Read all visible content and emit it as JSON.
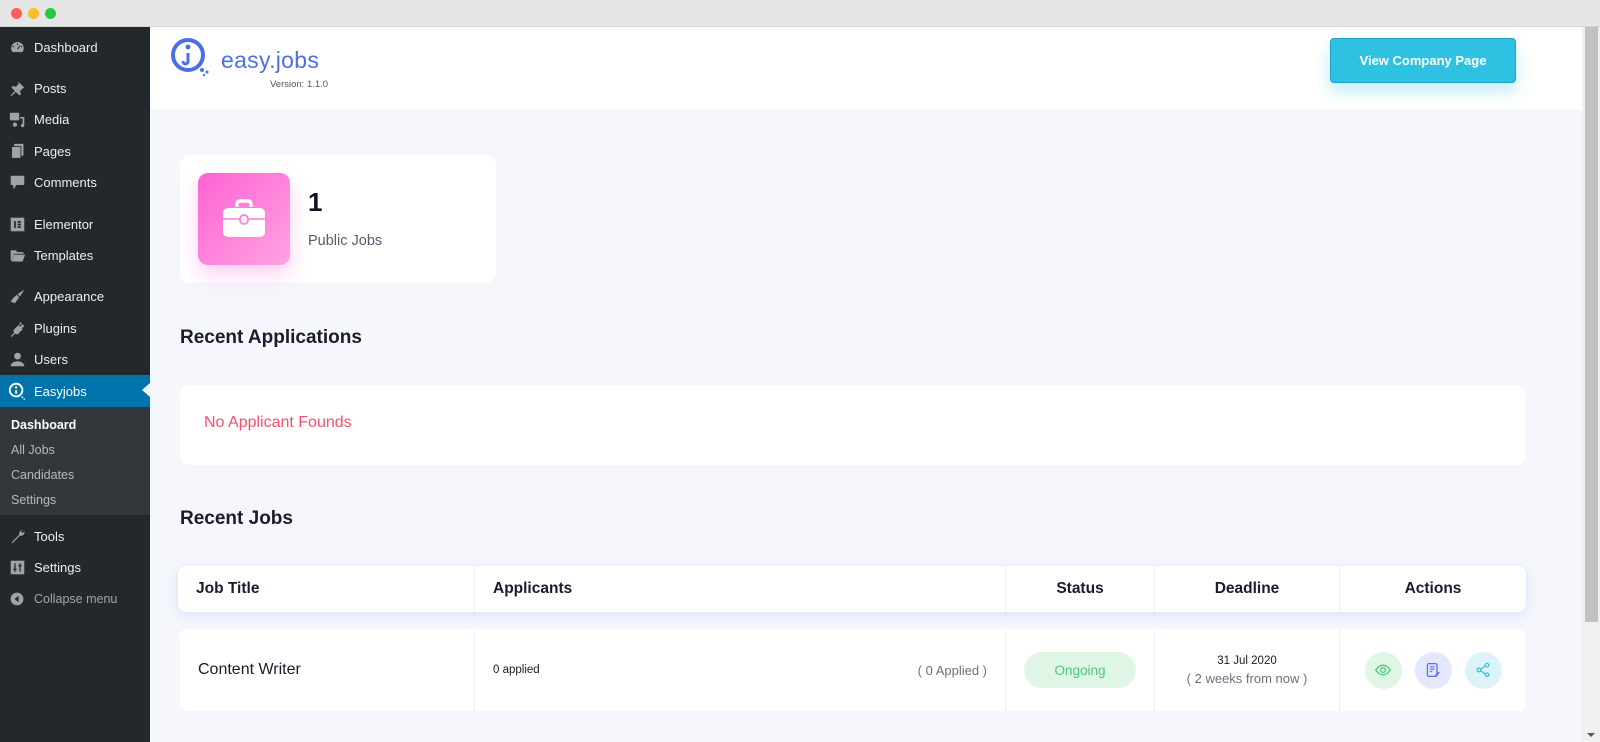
{
  "window": {
    "controls": [
      "close",
      "minimize",
      "maximize"
    ]
  },
  "sidebar": {
    "items": [
      {
        "label": "Dashboard",
        "icon": "dashboard-icon"
      },
      {
        "label": "Posts",
        "icon": "pin-icon"
      },
      {
        "label": "Media",
        "icon": "media-icon"
      },
      {
        "label": "Pages",
        "icon": "pages-icon"
      },
      {
        "label": "Comments",
        "icon": "comment-icon"
      },
      {
        "label": "Elementor",
        "icon": "elementor-icon"
      },
      {
        "label": "Templates",
        "icon": "folder-icon"
      },
      {
        "label": "Appearance",
        "icon": "brush-icon"
      },
      {
        "label": "Plugins",
        "icon": "plug-icon"
      },
      {
        "label": "Users",
        "icon": "user-icon"
      },
      {
        "label": "Easyjobs",
        "icon": "easyjobs-icon",
        "active": true
      },
      {
        "label": "Tools",
        "icon": "wrench-icon"
      },
      {
        "label": "Settings",
        "icon": "settings-icon"
      }
    ],
    "submenu": [
      {
        "label": "Dashboard",
        "current": true
      },
      {
        "label": "All Jobs"
      },
      {
        "label": "Candidates"
      },
      {
        "label": "Settings"
      }
    ],
    "collapse_label": "Collapse menu"
  },
  "header": {
    "logo_text": "easy.jobs",
    "version": "Version: 1.1.0",
    "company_button": "View Company Page"
  },
  "stats": {
    "public_jobs": {
      "value": "1",
      "label": "Public Jobs"
    }
  },
  "recent_applications": {
    "title": "Recent Applications",
    "empty_message": "No Applicant Founds"
  },
  "recent_jobs": {
    "title": "Recent Jobs",
    "columns": [
      "Job Title",
      "Applicants",
      "Status",
      "Deadline",
      "Actions"
    ],
    "rows": [
      {
        "title": "Content Writer",
        "applicants": "0 applied",
        "applied_count": "( 0 Applied )",
        "status": "Ongoing",
        "deadline_date": "31 Jul 2020",
        "deadline_relative": "( 2 weeks from now )",
        "actions": [
          "view-icon",
          "edit-icon",
          "share-icon"
        ]
      }
    ]
  },
  "colors": {
    "accent": "#0073aa",
    "brand": "#4c6fe8",
    "button": "#2ec1e2",
    "error": "#f7506c",
    "status_ongoing": "#4cc97a"
  }
}
